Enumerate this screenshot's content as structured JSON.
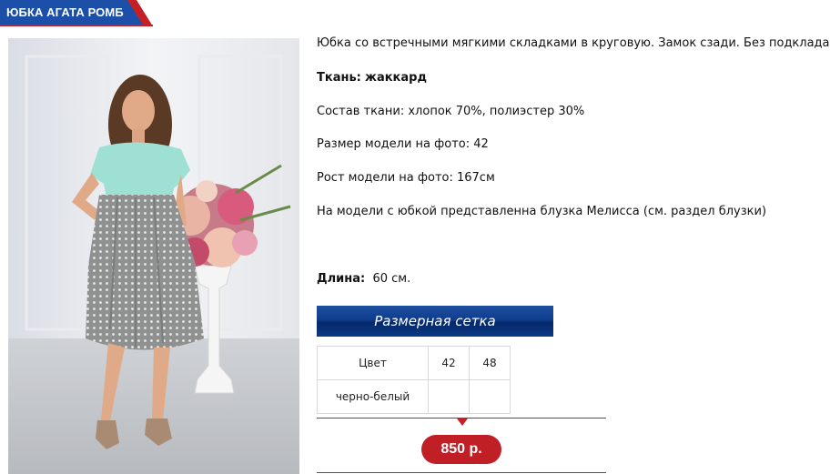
{
  "product": {
    "title": "ЮБКА АГАТА РОМБ",
    "description": "Юбка со встречными мягкими складками в круговую. Замок сзади. Без подклада.",
    "fabric_label": "Ткань:",
    "fabric_value": "жаккард",
    "composition": "Состав ткани: хлопок 70%, полиэстер 30%",
    "model_size": "Размер модели на фото: 42",
    "model_height": "Рост модели на фото: 167см",
    "blouse_note": "На модели с юбкой представленна блузка Мелисса (см. раздел блузки)",
    "length_label": "Длина:",
    "length_value": "60 см.",
    "size_chart_button": "Размерная сетка",
    "price": "850 р."
  },
  "size_table": {
    "header": [
      "Цвет",
      "42",
      "48"
    ],
    "rows": [
      [
        "черно-белый",
        "",
        ""
      ]
    ]
  },
  "colors": {
    "title_red": "#c52026",
    "title_blue": "#1b4fa8",
    "button_blue": "#0f3d8d",
    "price_red": "#c01f26"
  }
}
